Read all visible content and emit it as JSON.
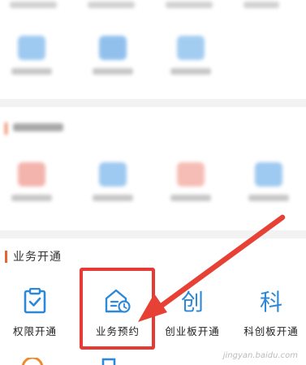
{
  "section": {
    "title": "业务开通",
    "accent": "#e7632f"
  },
  "business_items": [
    {
      "label": "权限开通",
      "icon": "clipboard-check-icon"
    },
    {
      "label": "业务预约",
      "icon": "house-clock-icon"
    },
    {
      "label": "创业板开通",
      "glyph": "创"
    },
    {
      "label": "科创板开通",
      "glyph": "科"
    }
  ],
  "colors": {
    "brand_blue": "#2e88d8",
    "arrow_red": "#e64134",
    "highlight_red": "#e63b35"
  },
  "watermark": "jingyan.baidu.com"
}
